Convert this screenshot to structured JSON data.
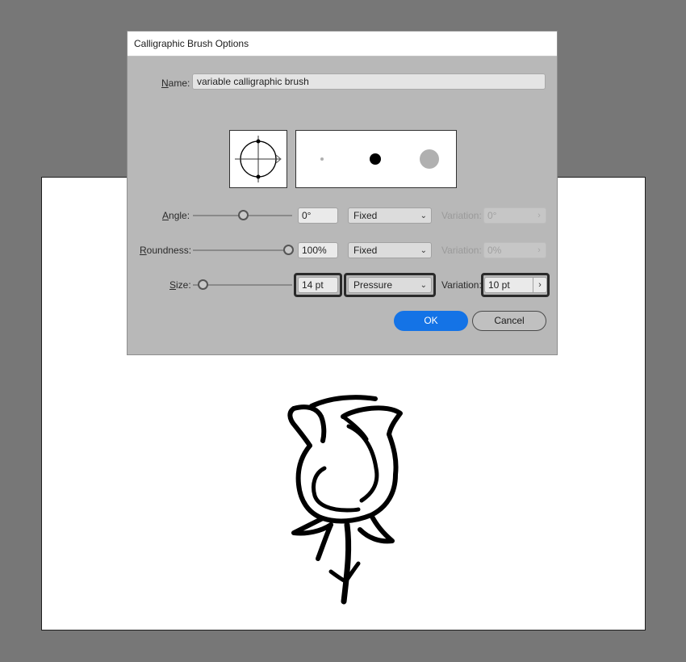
{
  "dialog": {
    "title": "Calligraphic Brush Options",
    "name_label": "Name:",
    "name_value": "variable calligraphic brush",
    "rows": {
      "angle": {
        "label": "Angle:",
        "value": "0°",
        "mode": "Fixed",
        "variation_label": "Variation:",
        "variation_value": "0°",
        "enabled_variation": false
      },
      "roundness": {
        "label": "Roundness:",
        "value": "100%",
        "mode": "Fixed",
        "variation_label": "Variation:",
        "variation_value": "0%",
        "enabled_variation": false
      },
      "size": {
        "label": "Size:",
        "value": "14 pt",
        "mode": "Pressure",
        "variation_label": "Variation:",
        "variation_value": "10 pt",
        "enabled_variation": true
      }
    },
    "ok_label": "OK",
    "cancel_label": "Cancel"
  },
  "icons": {
    "chevron": "chevron-down-icon",
    "stepper": "chevron-right-icon"
  },
  "colors": {
    "workspace": "#777777",
    "dialog_bg": "#b8b8b8",
    "ok_blue": "#1473e6",
    "preview_variation": "#b0b0b0"
  }
}
